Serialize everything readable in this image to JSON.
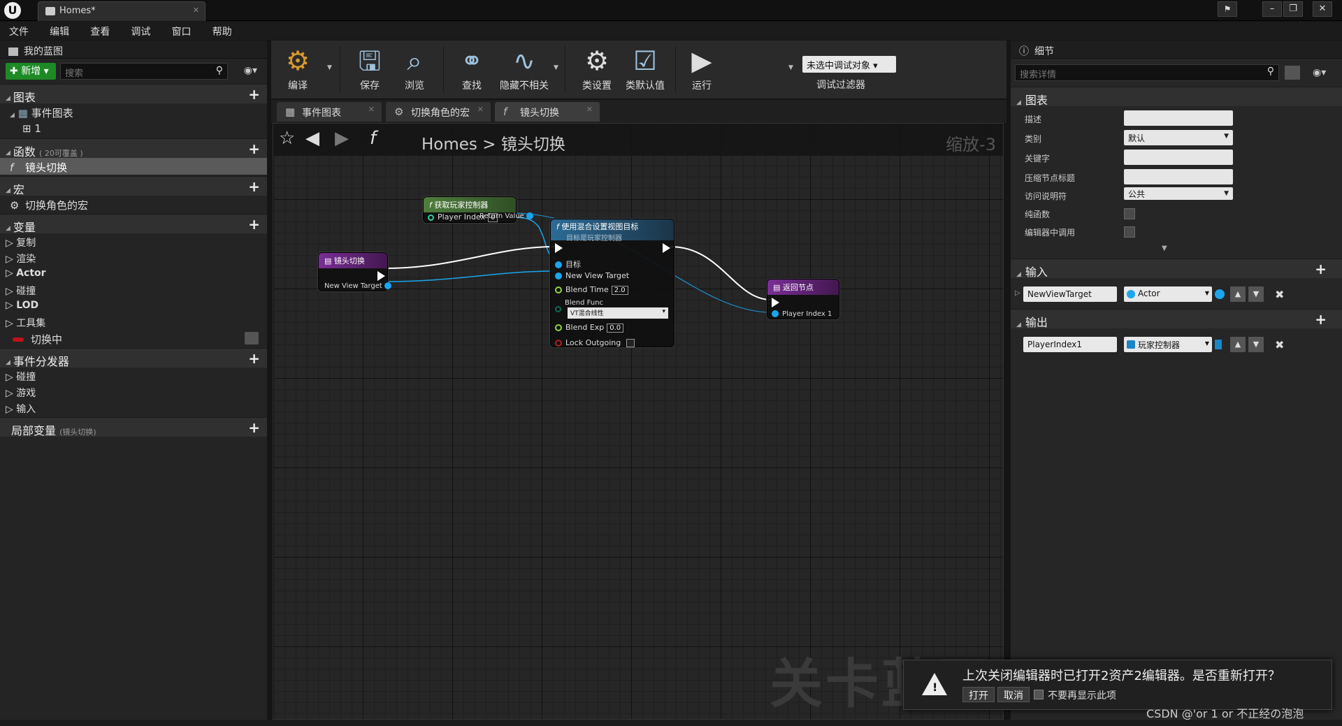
{
  "window": {
    "tab_title": "Homes*"
  },
  "menu": [
    "文件",
    "编辑",
    "查看",
    "调试",
    "窗口",
    "帮助"
  ],
  "left_panel": {
    "title": "我的蓝图",
    "add_label": "新增",
    "search_placeholder": "搜索",
    "sections": {
      "graphs": "图表",
      "event_graph": "事件图表",
      "event_graph_child": "1",
      "functions": "函数",
      "functions_sub": "( 20可覆盖 )",
      "function_item": "镜头切换",
      "macros": "宏",
      "macro_item": "切换角色的宏",
      "variables": "变量",
      "var_groups": [
        "复制",
        "渲染",
        "Actor",
        "碰撞",
        "LOD",
        "工具集"
      ],
      "var_item": "切换中",
      "dispatchers": "事件分发器",
      "disp_groups": [
        "碰撞",
        "游戏",
        "输入"
      ],
      "locals": "局部变量",
      "locals_sub": "(镜头切换)"
    }
  },
  "toolbar": {
    "compile": "编译",
    "save": "保存",
    "browse": "浏览",
    "find": "查找",
    "hide_unrelated": "隐藏不相关",
    "class_settings": "类设置",
    "class_defaults": "类默认值",
    "run": "运行",
    "debug_object": "未选中调试对象",
    "debug_filter": "调试过滤器"
  },
  "graph_tabs": [
    "事件图表",
    "切换角色的宏",
    "镜头切换"
  ],
  "breadcrumb": {
    "root": "Homes",
    "sep": ">",
    "current": "镜头切换"
  },
  "zoom_label": "缩放-3",
  "watermark": "关卡蓝图",
  "nodes": {
    "get_pc": {
      "title": "获取玩家控制器",
      "player_index_label": "Player Index",
      "player_index_value": "0",
      "return_label": "Return Value"
    },
    "entry": {
      "title": "镜头切换",
      "pin": "New View Target"
    },
    "blend": {
      "title": "使用混合设置视图目标",
      "subtitle": "目标是玩家控制器",
      "target": "目标",
      "nvt": "New View Target",
      "blend_time_label": "Blend Time",
      "blend_time": "2.0",
      "blend_func_label": "Blend Func",
      "blend_func": "VT混合线性",
      "blend_exp_label": "Blend Exp",
      "blend_exp": "0.0",
      "lock_outgoing": "Lock Outgoing"
    },
    "ret": {
      "title": "返回节点",
      "pin": "Player Index 1"
    }
  },
  "details": {
    "title": "细节",
    "search_placeholder": "搜索详情",
    "graph_cat": "图表",
    "props": [
      {
        "label": "描述",
        "value": ""
      },
      {
        "label": "类别",
        "value": "默认"
      },
      {
        "label": "关键字",
        "value": ""
      },
      {
        "label": "压缩节点标题",
        "value": ""
      },
      {
        "label": "访问说明符",
        "value": "公共"
      },
      {
        "label": "纯函数",
        "value": ""
      },
      {
        "label": "编辑器中调用",
        "value": ""
      }
    ],
    "inputs_cat": "输入",
    "input_name": "NewViewTarget",
    "input_type": "Actor",
    "outputs_cat": "输出",
    "output_name": "PlayerIndex1",
    "output_type": "玩家控制器"
  },
  "notification": {
    "message": "上次关闭编辑器时已打开2资产2编辑器。是否重新打开？",
    "open": "打开",
    "cancel": "取消",
    "dont_show": "不要再显示此项"
  },
  "csdn": "CSDN @'or 1 or 不正经の泡泡",
  "colors": {
    "exec": "#ffffff",
    "object_pin": "#1aa6ee",
    "float_pin": "#8fd63a",
    "add_green": "#1d8a26"
  }
}
